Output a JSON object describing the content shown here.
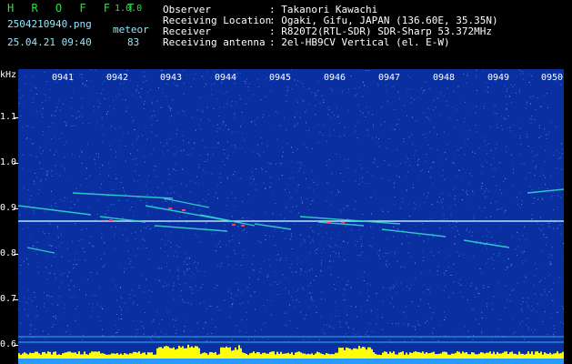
{
  "header": {
    "app_name": "H R O F F T",
    "version": "1.0.0",
    "filename": "2504210940.png",
    "datetime": "25.04.21 09:40",
    "mode_label": "meteor",
    "count": "83",
    "observer_label": "Observer",
    "observer_value": ": Takanori Kawachi",
    "location_label": "Receiving Location",
    "location_value": ": Ogaki, Gifu, JAPAN (136.60E, 35.35N)",
    "receiver_label": "Receiver",
    "receiver_value": ": R820T2(RTL-SDR) SDR-Sharp 53.372MHz",
    "antenna_label": "Receiving antenna",
    "antenna_value": ": 2el-HB9CV Vertical (el. E-W)"
  },
  "spectrogram": {
    "unit_label": "kHz",
    "y_ticks": [
      "1.1",
      "1.0",
      "0.9",
      "0.8",
      "0.7",
      "0.6"
    ],
    "time_labels": [
      "0941",
      "0942",
      "0943",
      "0944",
      "0945",
      "0946",
      "0947",
      "0948",
      "0949",
      "0950"
    ],
    "colors": {
      "background": "#0a2fa0",
      "noise": "#3f8cff",
      "carrier": "#c8f8ff",
      "echo": "#34e0d0",
      "hot": "#ff3a55",
      "level": "#ffff00",
      "floor": "#40e8ff"
    }
  }
}
